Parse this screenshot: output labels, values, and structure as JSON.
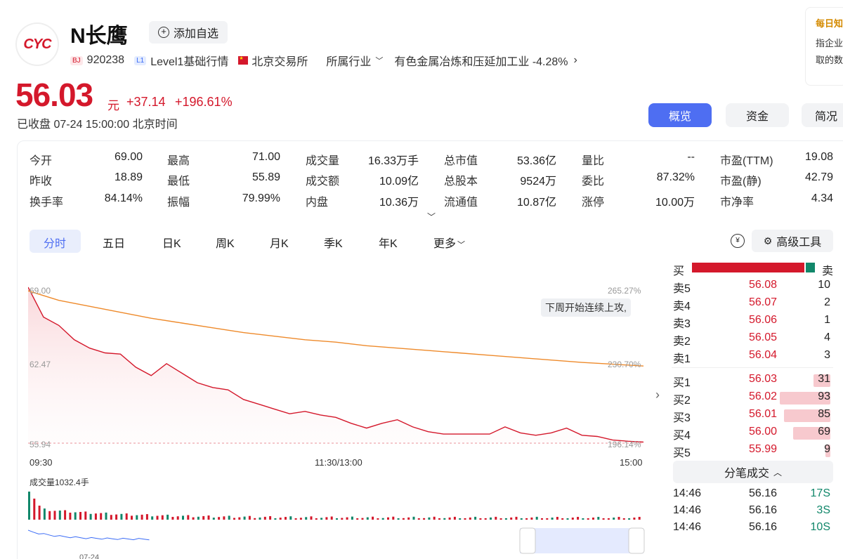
{
  "header": {
    "logo_text": "CYC",
    "name": "N长鹰",
    "fav_label": "添加自选",
    "bj_tag": "BJ",
    "code": "920238",
    "l1_tag": "L1",
    "level": "Level1基础行情",
    "exchange": "北京交易所",
    "industry_label": "所属行业",
    "industry": "有色金属冶炼和压延加工业 -4.28%"
  },
  "quote": {
    "price": "56.03",
    "unit": "元",
    "change": "+37.14",
    "change_pct": "+196.61%",
    "status": "已收盘",
    "time": "07-24 15:00:00 北京时间"
  },
  "top_tabs": [
    "概览",
    "资金",
    "简况"
  ],
  "side_panel": {
    "title": "每日知",
    "line1": "指企业",
    "line2": "取的数"
  },
  "stats": [
    [
      {
        "l": "今开",
        "v": "69.00",
        "c": "red"
      },
      {
        "l": "最高",
        "v": "71.00",
        "c": "red"
      },
      {
        "l": "成交量",
        "v": "16.33万手",
        "c": ""
      },
      {
        "l": "总市值",
        "v": "53.36亿",
        "c": ""
      },
      {
        "l": "量比",
        "v": "--",
        "c": ""
      },
      {
        "l": "市盈(TTM)",
        "v": "19.08",
        "c": ""
      }
    ],
    [
      {
        "l": "昨收",
        "v": "18.89",
        "c": ""
      },
      {
        "l": "最低",
        "v": "55.89",
        "c": "red"
      },
      {
        "l": "成交额",
        "v": "10.09亿",
        "c": ""
      },
      {
        "l": "总股本",
        "v": "9524万",
        "c": ""
      },
      {
        "l": "委比",
        "v": "87.32%",
        "c": ""
      },
      {
        "l": "市盈(静)",
        "v": "42.79",
        "c": ""
      }
    ],
    [
      {
        "l": "换手率",
        "v": "84.14%",
        "c": ""
      },
      {
        "l": "振幅",
        "v": "79.99%",
        "c": ""
      },
      {
        "l": "内盘",
        "v": "10.36万",
        "c": "green"
      },
      {
        "l": "流通值",
        "v": "10.87亿",
        "c": ""
      },
      {
        "l": "涨停",
        "v": "10.00万",
        "c": "green"
      },
      {
        "l": "市净率",
        "v": "4.34",
        "c": ""
      }
    ]
  ],
  "chart_tabs": [
    "分时",
    "五日",
    "日K",
    "周K",
    "月K",
    "季K",
    "年K",
    "更多"
  ],
  "tools_label": "高级工具",
  "chart": {
    "y_top": "69.00",
    "y_mid": "62.47",
    "y_low": "55.94",
    "r_top": "265.27%",
    "r_mid": "230.70%",
    "r_low": "196.14%",
    "x_start": "09:30",
    "x_mid": "11:30/13:00",
    "x_end": "15:00",
    "annotation": "下周开始连续上攻,",
    "volume_label": "成交量1032.4手",
    "nav_date": "07-24"
  },
  "chart_data": {
    "type": "line",
    "ylim": [
      55.94,
      69.0
    ],
    "series": [
      {
        "values": [
          69.0,
          66.5,
          65.8,
          64.6,
          63.9,
          63.5,
          63.4,
          62.3,
          61.6,
          62.6,
          61.8,
          61.0,
          60.6,
          60.4,
          59.6,
          59.2,
          58.8,
          58.4,
          58.6,
          58.3,
          58.1,
          57.6,
          57.2,
          57.6,
          57.9,
          57.3,
          56.9,
          56.7,
          56.7,
          56.7,
          56.7,
          57.3,
          56.8,
          56.6,
          56.8,
          57.2,
          56.6,
          56.5,
          56.2,
          56.1,
          56.03
        ]
      },
      {
        "values": [
          68.7,
          67.9,
          67.4,
          66.9,
          66.4,
          66.0,
          65.6,
          65.2,
          64.9,
          64.6,
          64.4,
          64.1,
          63.9,
          63.7,
          63.5,
          63.3,
          63.1,
          62.9,
          62.7,
          62.55,
          62.4
        ]
      }
    ]
  },
  "orderbook": {
    "buy_label": "买",
    "sell_label": "卖",
    "asks": [
      {
        "n": "卖5",
        "p": "56.08",
        "v": "10"
      },
      {
        "n": "卖4",
        "p": "56.07",
        "v": "2"
      },
      {
        "n": "卖3",
        "p": "56.06",
        "v": "1"
      },
      {
        "n": "卖2",
        "p": "56.05",
        "v": "4"
      },
      {
        "n": "卖1",
        "p": "56.04",
        "v": "3"
      }
    ],
    "bids": [
      {
        "n": "买1",
        "p": "56.03",
        "v": "31"
      },
      {
        "n": "买2",
        "p": "56.02",
        "v": "93"
      },
      {
        "n": "买3",
        "p": "56.01",
        "v": "85"
      },
      {
        "n": "买4",
        "p": "56.00",
        "v": "69"
      },
      {
        "n": "买5",
        "p": "55.99",
        "v": "9"
      }
    ],
    "trades_label": "分笔成交",
    "trades": [
      {
        "t": "14:46",
        "p": "56.16",
        "v": "17S"
      },
      {
        "t": "14:46",
        "p": "56.16",
        "v": "3S"
      },
      {
        "t": "14:46",
        "p": "56.16",
        "v": "10S"
      }
    ]
  }
}
